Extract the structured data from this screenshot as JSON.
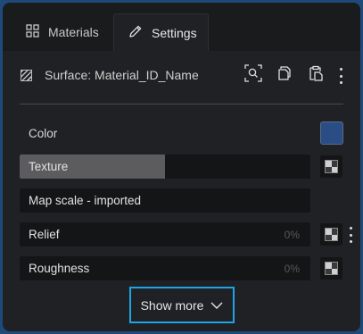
{
  "tabs": [
    {
      "label": "Materials",
      "icon": "grid-icon",
      "active": false
    },
    {
      "label": "Settings",
      "icon": "pencil-icon",
      "active": true
    }
  ],
  "surface": {
    "label": "Surface: Material_ID_Name",
    "icon": "hatched-square-icon",
    "tools": [
      "zoom-search-icon",
      "duplicate-icon",
      "paste-icon",
      "more-vertical-icon"
    ]
  },
  "properties": {
    "color": {
      "label": "Color",
      "swatch": "#2a4d85"
    },
    "texture": {
      "label": "Texture",
      "fill": 0.5
    },
    "map_scale": {
      "label": "Map scale - imported"
    },
    "relief": {
      "label": "Relief",
      "value": "0%"
    },
    "roughness": {
      "label": "Roughness",
      "value": "0%"
    }
  },
  "show_more": {
    "label": "Show more",
    "icon": "chevron-down-icon"
  },
  "colors": {
    "accent": "#1ea5e6",
    "panel": "#202124",
    "frame": "#1e4a7a"
  }
}
